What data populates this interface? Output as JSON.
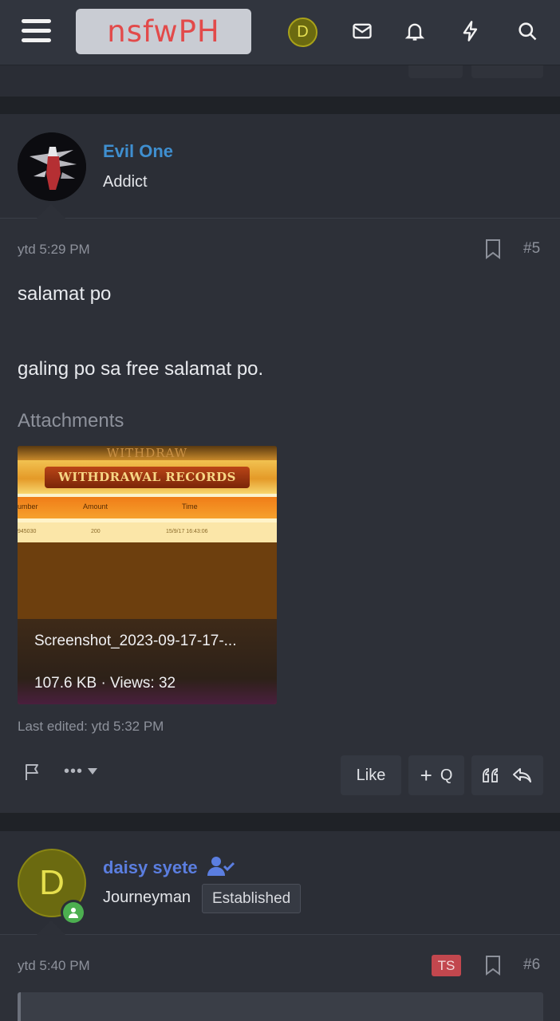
{
  "header": {
    "logo_text": "nsfwPH",
    "avatar_letter": "D",
    "icons": [
      "menu-icon",
      "envelope-icon",
      "bell-icon",
      "lightning-icon",
      "search-icon"
    ]
  },
  "post5": {
    "author": "Evil One",
    "author_color": "#3f8fd0",
    "user_title": "Addict",
    "time": "ytd 5:29 PM",
    "number": "#5",
    "lines": [
      "salamat po",
      "galing po sa free salamat po."
    ],
    "attachments_label": "Attachments",
    "attachment": {
      "header_text_1": "WITHDRAW",
      "header_text_2": "WITHDRAWAL RECORDS",
      "columns": [
        "umber",
        "Amount",
        "Time",
        ""
      ],
      "row": [
        "945030",
        "200",
        "15/9/17 16:43:06",
        ""
      ],
      "filename": "Screenshot_2023-09-17-17-...",
      "size_views": "107.6 KB · Views: 32"
    },
    "last_edited": "Last edited: ytd 5:32 PM",
    "actions": {
      "like": "Like",
      "multiquote": "Q",
      "report_icon": "flag-icon",
      "more_icon": "more-icon"
    }
  },
  "post6": {
    "author": "daisy syete",
    "author_color": "#5b7ee0",
    "avatar_letter": "D",
    "user_title": "Journeyman",
    "banner": "Established",
    "time": "ytd 5:40 PM",
    "ts_badge": "TS",
    "number": "#6"
  }
}
